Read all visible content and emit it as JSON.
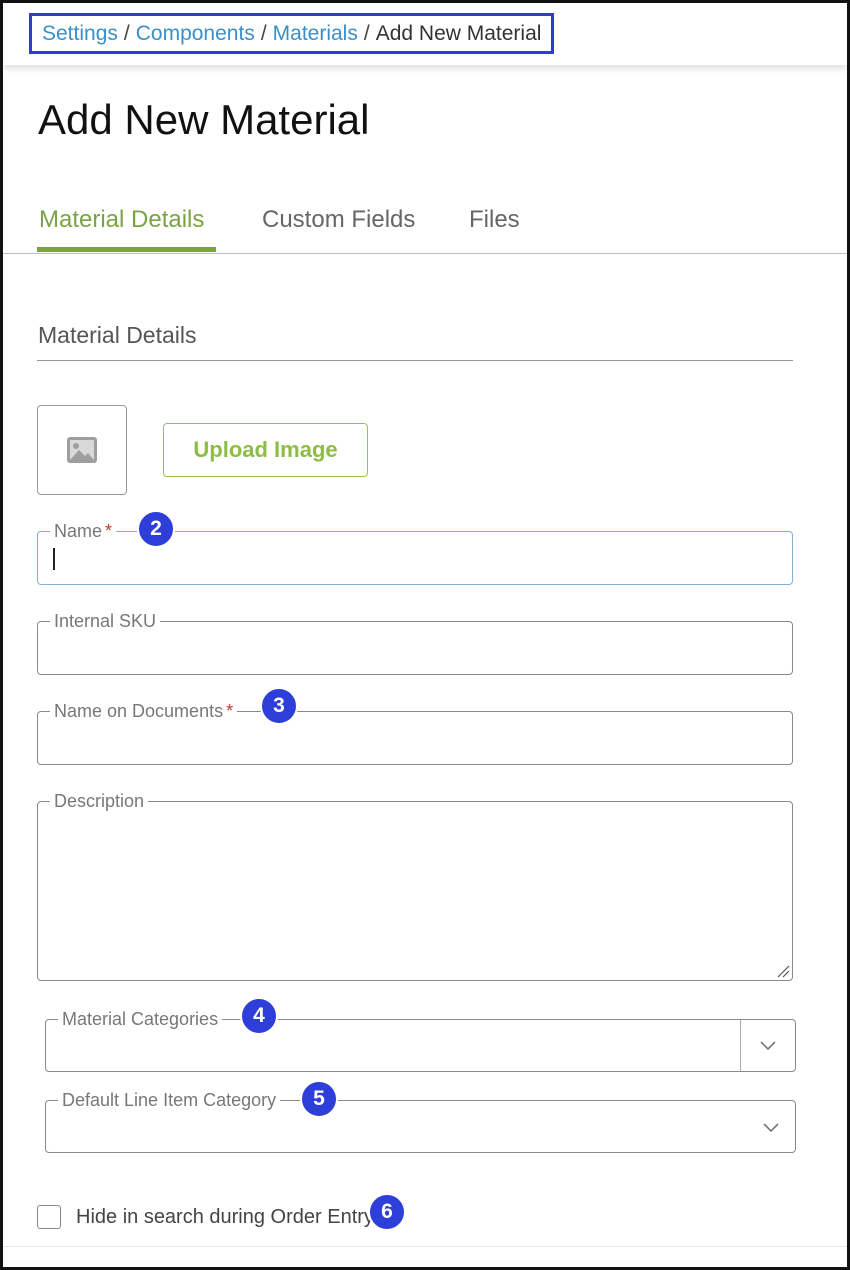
{
  "breadcrumb": {
    "items": [
      "Settings",
      "Components",
      "Materials"
    ],
    "separator": "/",
    "current": "Add New Material"
  },
  "page": {
    "title": "Add New Material"
  },
  "tabs": [
    {
      "label": "Material Details",
      "active": true
    },
    {
      "label": "Custom Fields",
      "active": false
    },
    {
      "label": "Files",
      "active": false
    }
  ],
  "section": {
    "title": "Material Details"
  },
  "image": {
    "icon": "image-placeholder-icon",
    "upload_label": "Upload Image"
  },
  "fields": {
    "name": {
      "label": "Name",
      "required_mark": "*",
      "value": ""
    },
    "internal_sku": {
      "label": "Internal SKU",
      "value": ""
    },
    "name_on_documents": {
      "label": "Name on Documents",
      "required_mark": "*",
      "value": ""
    },
    "description": {
      "label": "Description",
      "value": ""
    },
    "material_categories": {
      "label": "Material Categories",
      "value": ""
    },
    "default_line_item_category": {
      "label": "Default Line Item Category",
      "value": ""
    }
  },
  "hide_in_search": {
    "label": "Hide in search during Order Entry",
    "checked": false
  },
  "badges": [
    "2",
    "3",
    "4",
    "5",
    "6"
  ],
  "colors": {
    "accent_green": "#7aa342",
    "link_blue": "#3b8fc7",
    "badge_blue": "#2e3ed8",
    "required_red": "#c0392b"
  }
}
